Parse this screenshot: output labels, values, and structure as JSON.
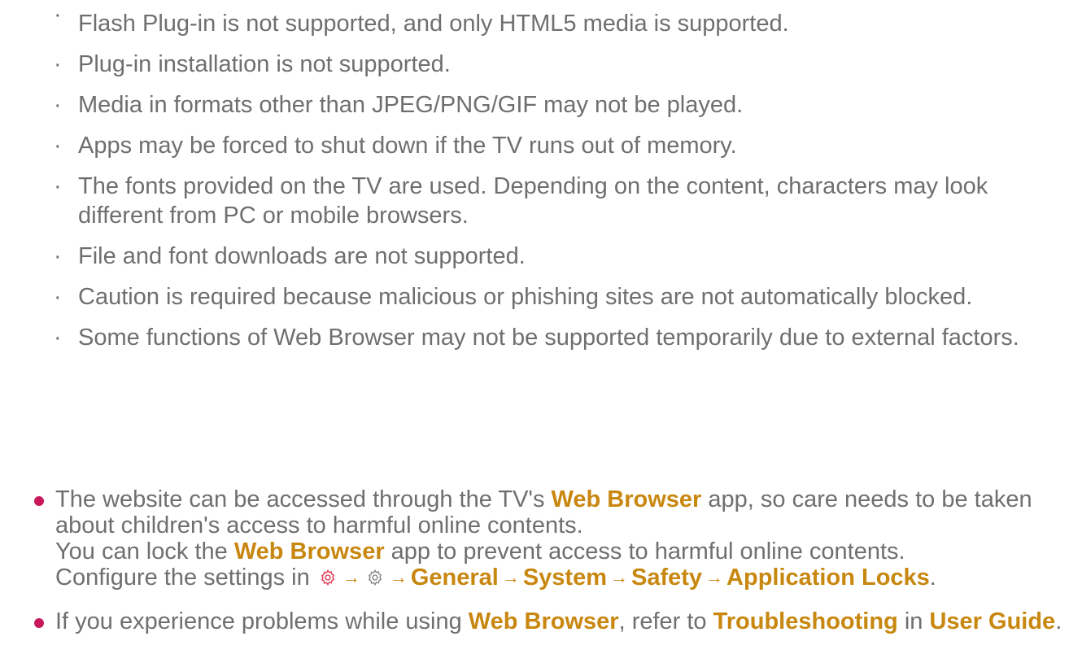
{
  "notes": [
    "Flash Plug-in is not supported, and only HTML5 media is supported.",
    "Plug-in installation is not supported.",
    "Media in formats other than JPEG/PNG/GIF may not be played.",
    "Apps may be forced to shut down if the TV runs out of memory.",
    "The fonts provided on the TV are used. Depending on the content, characters may look different from PC or mobile browsers.",
    "File and font downloads are not supported.",
    "Caution is required because malicious or phishing sites are not automatically blocked.",
    "Some functions of Web Browser may not be supported temporarily due to external factors."
  ],
  "note_marker": "·",
  "bullet1": {
    "line1_pre": "The website can be accessed through the TV's ",
    "line1_hl": "Web Browser",
    "line1_post": " app, so care needs to be taken about children's access to harmful online contents.",
    "line2_pre": "You can lock the ",
    "line2_hl": "Web Browser",
    "line2_post": " app to prevent access to harmful online contents.",
    "line3_pre": "Configure the settings in ",
    "path": [
      "General",
      "System",
      "Safety",
      "Application Locks"
    ],
    "arrow": "→",
    "line3_end": "."
  },
  "bullet2": {
    "pre": "If you experience problems while using ",
    "hl1": "Web Browser",
    "mid": ", refer to ",
    "hl2": "Troubleshooting",
    "mid2": " in ",
    "hl3": "User Guide",
    "end": "."
  },
  "colors": {
    "text": "#6f6f6f",
    "highlight": "#c8870f",
    "bullet": "#c8185a",
    "remote_gear": "#e0405a",
    "settings_gear": "#8a8a8a"
  },
  "icons": [
    "remote-settings-gear-icon",
    "settings-gear-icon",
    "arrow-right-icon"
  ]
}
